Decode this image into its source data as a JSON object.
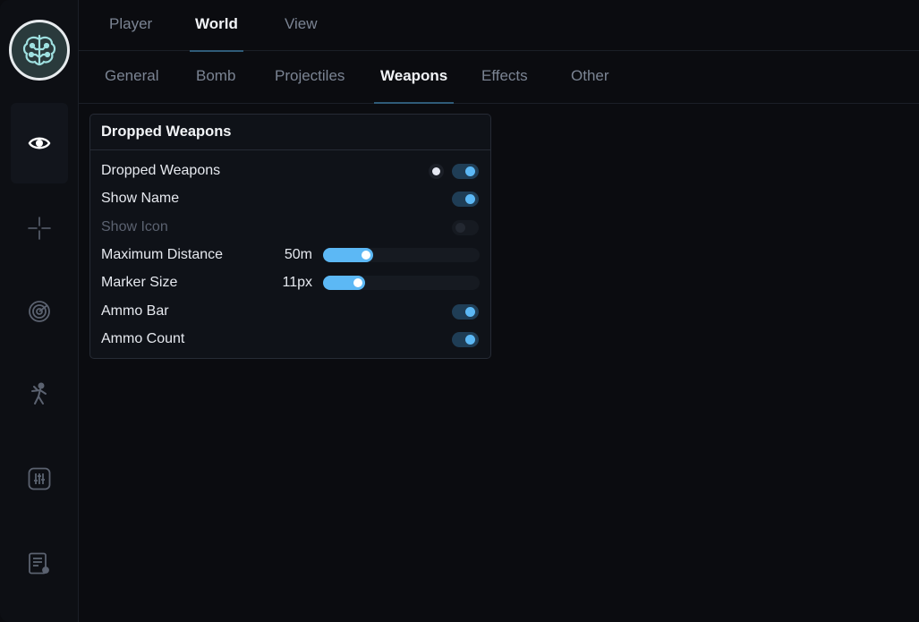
{
  "top_tabs": [
    "Player",
    "World",
    "View"
  ],
  "top_active": "World",
  "sub_tabs": [
    "General",
    "Bomb",
    "Projectiles",
    "Weapons",
    "Effects",
    "Other"
  ],
  "sub_active": "Weapons",
  "sidebar": {
    "items": [
      {
        "icon": "eye-icon",
        "active": true
      },
      {
        "icon": "crosshair-icon",
        "active": false
      },
      {
        "icon": "radar-icon",
        "active": false
      },
      {
        "icon": "figure-icon",
        "active": false
      },
      {
        "icon": "sliders-icon",
        "active": false
      },
      {
        "icon": "list-settings-icon",
        "active": false
      }
    ]
  },
  "panel": {
    "title": "Dropped Weapons",
    "rows": [
      {
        "label": "Dropped Weapons",
        "type": "toggle",
        "on": true,
        "has_color": true,
        "color": "#e6e9f3"
      },
      {
        "label": "Show Name",
        "type": "toggle",
        "on": true
      },
      {
        "label": "Show Icon",
        "type": "toggle",
        "on": false,
        "disabled": true
      },
      {
        "label": "Maximum Distance",
        "type": "slider",
        "value": "50m",
        "fraction": 0.32
      },
      {
        "label": "Marker Size",
        "type": "slider",
        "value": "11px",
        "fraction": 0.27
      },
      {
        "label": "Ammo Bar",
        "type": "toggle",
        "on": true
      },
      {
        "label": "Ammo Count",
        "type": "toggle",
        "on": true
      }
    ]
  },
  "colors": {
    "accent": "#5cb8f5",
    "toggle_on_track": "#1f3d55",
    "background": "#0b0c10",
    "panel": "#0f1218"
  }
}
